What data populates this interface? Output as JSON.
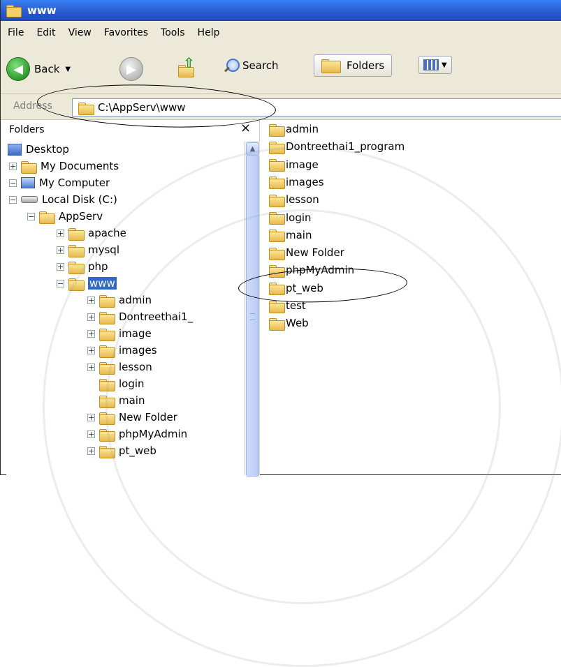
{
  "window": {
    "title": "www"
  },
  "menu": [
    "File",
    "Edit",
    "View",
    "Favorites",
    "Tools",
    "Help"
  ],
  "toolbar": {
    "back_label": "Back",
    "search_label": "Search",
    "folders_label": "Folders"
  },
  "address": {
    "label": "Address",
    "path": "C:\\AppServ\\www"
  },
  "folder_pane": {
    "header": "Folders",
    "close_glyph": "×",
    "tree": [
      {
        "label": "Desktop",
        "level": 0,
        "expander": ""
      },
      {
        "label": "My Documents",
        "level": 1,
        "expander": "+"
      },
      {
        "label": "My Computer",
        "level": 1,
        "expander": "−"
      },
      {
        "label": "Local Disk (C:)",
        "level": 2,
        "expander": "−"
      },
      {
        "label": "AppServ",
        "level": 3,
        "expander": "−"
      },
      {
        "label": "apache",
        "level": 4,
        "expander": "+"
      },
      {
        "label": "mysql",
        "level": 4,
        "expander": "+"
      },
      {
        "label": "php",
        "level": 4,
        "expander": "+"
      },
      {
        "label": "www",
        "level": 4,
        "expander": "−",
        "selected": true
      },
      {
        "label": "admin",
        "level": 5,
        "expander": "+"
      },
      {
        "label": "Dontreethai1_",
        "level": 5,
        "expander": "+"
      },
      {
        "label": "image",
        "level": 5,
        "expander": "+"
      },
      {
        "label": "images",
        "level": 5,
        "expander": "+"
      },
      {
        "label": "lesson",
        "level": 5,
        "expander": "+"
      },
      {
        "label": "login",
        "level": 5,
        "expander": ""
      },
      {
        "label": "main",
        "level": 5,
        "expander": ""
      },
      {
        "label": "New Folder",
        "level": 5,
        "expander": "+"
      },
      {
        "label": "phpMyAdmin",
        "level": 5,
        "expander": "+"
      },
      {
        "label": "pt_web",
        "level": 5,
        "expander": "+"
      }
    ]
  },
  "content_pane": {
    "items": [
      "admin",
      "Dontreethai1_program",
      "image",
      "images",
      "lesson",
      "login",
      "main",
      "New Folder",
      "phpMyAdmin",
      "pt_web",
      "test",
      "Web"
    ]
  },
  "colors": {
    "titlebar": "#2b62d6",
    "selection": "#316ac5",
    "chrome": "#ece9d8"
  }
}
